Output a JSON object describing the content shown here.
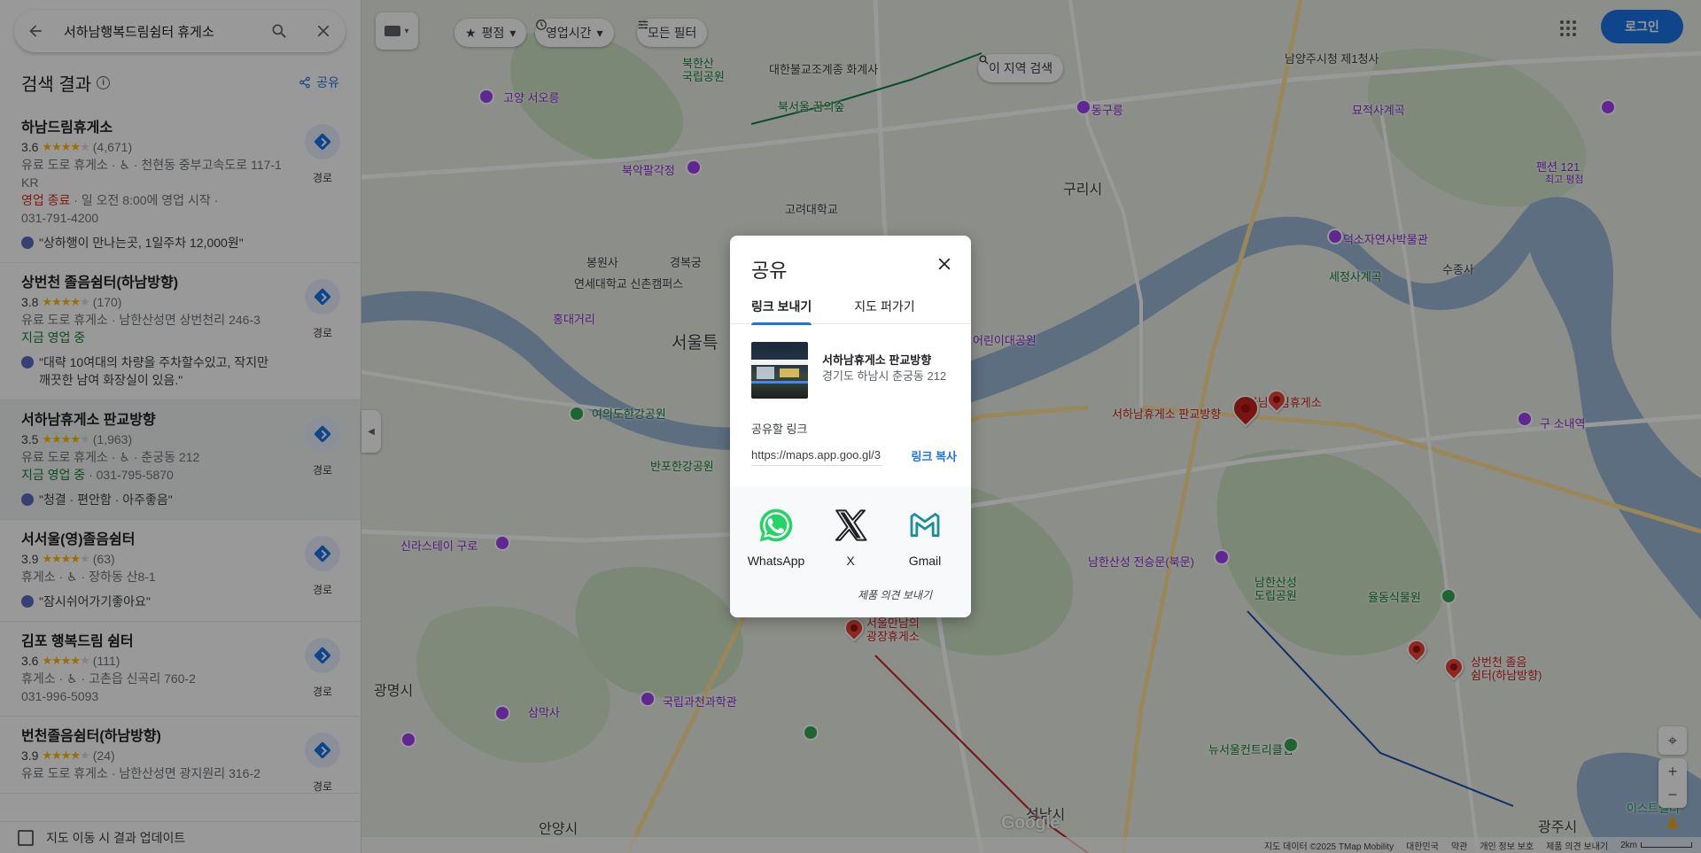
{
  "search": {
    "query": "서하남행복드림쉼터 휴게소"
  },
  "results_header": {
    "title": "검색 결과",
    "share_label": "공유"
  },
  "results": [
    {
      "name": "하남드림휴게소",
      "rating": "3.6",
      "reviews": "(4,671)",
      "stars": 3.5,
      "line1": "유료 도로 휴게소 · ♿ · 천현동 중부고속도로 117-1 KR",
      "status": "영업 종료",
      "status_rest": " · 일 오전 8:00에 영업 시작 ·",
      "status_type": "closed",
      "phone": "031-791-4200",
      "review": "\"상하행이 만나는곳, 1일주차 12,000원\"",
      "route_label": "경로"
    },
    {
      "name": "상번천 졸음쉼터(하남방향)",
      "rating": "3.8",
      "reviews": "(170)",
      "stars": 4,
      "line1": "유료 도로 휴게소 · 남한산성면 상번천리 246-3",
      "status": "지금 영업 중",
      "status_rest": "",
      "status_type": "open",
      "phone": "",
      "review": "\"대략 10여대의 차량을 주차할수있고, 작지만 깨끗한 남여 화장실이 있음.\"",
      "route_label": "경로"
    },
    {
      "name": "서하남휴게소 판교방향",
      "rating": "3.5",
      "reviews": "(1,963)",
      "stars": 3.5,
      "line1": "유료 도로 휴게소 · ♿ · 춘궁동 212",
      "status": "지금 영업 중",
      "status_rest": " · 031-795-5870",
      "status_type": "open",
      "phone": "",
      "review": "\"청결 · 편안함 · 아주좋음\"",
      "route_label": "경로"
    },
    {
      "name": "서서울(영)졸음쉼터",
      "rating": "3.9",
      "reviews": "(63)",
      "stars": 4,
      "line1": "휴게소 · ♿ · 장하동 산8-1",
      "status": "",
      "status_rest": "",
      "status_type": "none",
      "phone": "",
      "review": "\"잠시쉬어가기좋아요\"",
      "route_label": "경로"
    },
    {
      "name": "김포 행복드림 쉼터",
      "rating": "3.6",
      "reviews": "(111)",
      "stars": 3.5,
      "line1": "휴게소 · ♿ · 고촌읍 신곡리 760-2",
      "status": "",
      "status_rest": "",
      "status_type": "none",
      "phone": "031-996-5093",
      "review": "",
      "route_label": "경로"
    },
    {
      "name": "번천졸음쉼터(하남방향)",
      "rating": "3.9",
      "reviews": "(24)",
      "stars": 4,
      "line1": "유료 도로 휴게소 · 남한산성면 광지원리 316-2",
      "status": "",
      "status_rest": "",
      "status_type": "none",
      "phone": "",
      "review": "",
      "route_label": "경로"
    }
  ],
  "footer": {
    "update_label": "지도 이동 시 결과 업데이트"
  },
  "map": {
    "chips": {
      "rating": "평점",
      "hours": "영업시간",
      "all_filters": "모든 필터",
      "search_area": "이 지역 검색"
    },
    "login": "로그인",
    "labels": {
      "seoul": "서울특",
      "guri": "구리시",
      "gwangmyeong": "광명시",
      "anyang": "안양시",
      "seongnam": "성남시",
      "gwangju": "광주시",
      "selected_pin": "서하남휴게소 판교방향",
      "hanam_dream": "하남드림휴게소",
      "seoul_mannam": "서울만남의\n광장휴게소",
      "sangbeon": "상번천 졸음\n쉼터(하남방향)",
      "bukhansan": "북한산\n국립공원",
      "gyeongbokgung": "경복궁",
      "goyang": "고양 서오릉",
      "bukak": "북악팔각정",
      "yeonsei": "연세대학교 신촌캠퍼스",
      "hongdae": "홍대거리",
      "yeouido": "여의도한강공원",
      "banpo": "반포한강공원",
      "sinrim": "신라스테이 구로",
      "gwacheon": "국립과천과학관",
      "samaksa": "삼막사",
      "namhansanseong": "남한산성\n도립공원",
      "namhan_gate": "남한산성 전승문(북문)",
      "dongguneung": "동구릉",
      "dasan": "덕소자연사박물관",
      "namyangju": "남양주시청 제1청사",
      "yulbong": "묘적사계곡",
      "sujongsa": "수종사",
      "seshin": "세정사계곡",
      "pension": "펜션 121",
      "pension_sub": "최고 평점",
      "gu_sonae": "구 소내역",
      "yulhwa": "율동식물원",
      "new_seoul_cc": "뉴서울컨트리클럽",
      "children": "어린이대공원",
      "dae_park": "대한불교조계종 화계사",
      "bukseoul": "북서울 꿈의숲",
      "goryeo": "고려대학교",
      "eastwell": "이스트밸리",
      "bongwon": "봉원사"
    },
    "attribution": [
      "지도 데이터 ©2025 TMap Mobility",
      "대한민국",
      "약관",
      "개인 정보 보호",
      "제품 의견 보내기",
      "2km"
    ],
    "google": "Google"
  },
  "dialog": {
    "title": "공유",
    "tabs": [
      "링크 보내기",
      "지도 퍼가기"
    ],
    "place_name": "서하남휴게소 판교방향",
    "place_address": "경기도 하남시 춘궁동 212",
    "link_label": "공유할 링크",
    "link_value": "https://maps.app.goo.gl/3",
    "copy_label": "링크 복사",
    "targets": [
      "WhatsApp",
      "X",
      "Gmail"
    ],
    "feedback": "제품 의견 보내기"
  }
}
